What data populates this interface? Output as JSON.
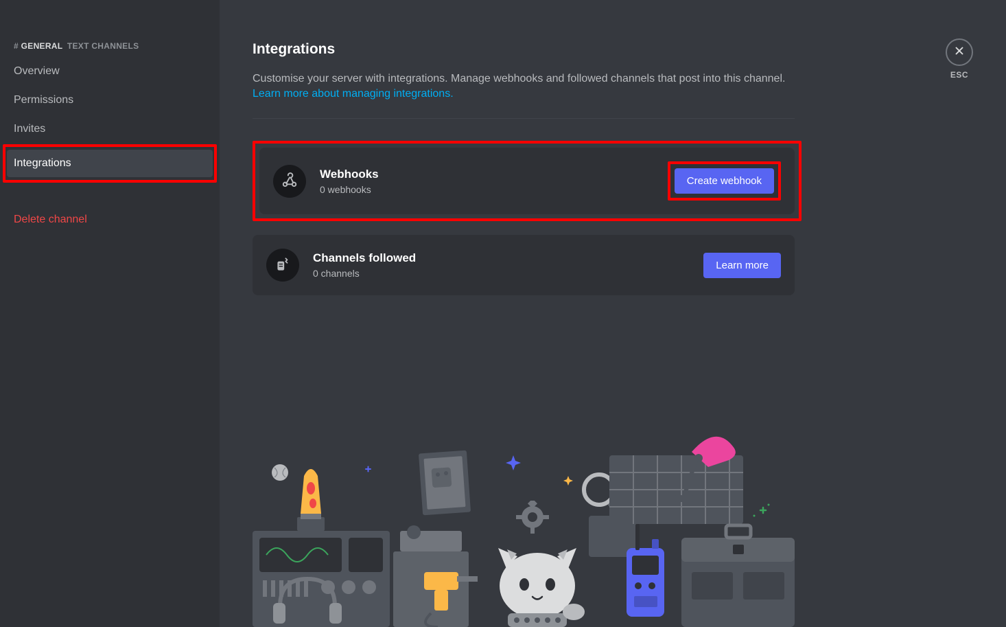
{
  "sidebar": {
    "header_hash": "#",
    "header_channel": "GENERAL",
    "header_rest": "TEXT CHANNELS",
    "items": [
      {
        "label": "Overview"
      },
      {
        "label": "Permissions"
      },
      {
        "label": "Invites"
      },
      {
        "label": "Integrations"
      },
      {
        "label": "Delete channel"
      }
    ]
  },
  "close": {
    "label": "ESC"
  },
  "page": {
    "title": "Integrations",
    "description_text": "Customise your server with integrations. Manage webhooks and followed channels that post into this channel. ",
    "description_link": "Learn more about managing integrations."
  },
  "cards": {
    "webhooks": {
      "title": "Webhooks",
      "subtitle": "0 webhooks",
      "button": "Create webhook"
    },
    "channels_followed": {
      "title": "Channels followed",
      "subtitle": "0 channels",
      "button": "Learn more"
    }
  }
}
